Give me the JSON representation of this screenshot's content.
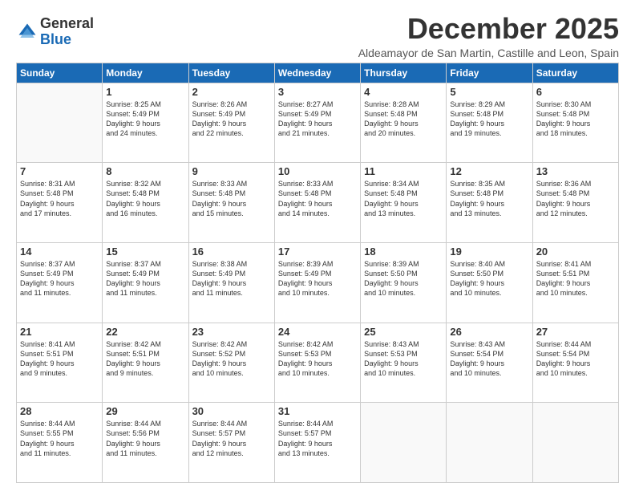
{
  "logo": {
    "general": "General",
    "blue": "Blue"
  },
  "title": "December 2025",
  "subtitle": "Aldeamayor de San Martin, Castille and Leon, Spain",
  "days_of_week": [
    "Sunday",
    "Monday",
    "Tuesday",
    "Wednesday",
    "Thursday",
    "Friday",
    "Saturday"
  ],
  "weeks": [
    [
      {
        "day": "",
        "info": ""
      },
      {
        "day": "1",
        "info": "Sunrise: 8:25 AM\nSunset: 5:49 PM\nDaylight: 9 hours\nand 24 minutes."
      },
      {
        "day": "2",
        "info": "Sunrise: 8:26 AM\nSunset: 5:49 PM\nDaylight: 9 hours\nand 22 minutes."
      },
      {
        "day": "3",
        "info": "Sunrise: 8:27 AM\nSunset: 5:49 PM\nDaylight: 9 hours\nand 21 minutes."
      },
      {
        "day": "4",
        "info": "Sunrise: 8:28 AM\nSunset: 5:48 PM\nDaylight: 9 hours\nand 20 minutes."
      },
      {
        "day": "5",
        "info": "Sunrise: 8:29 AM\nSunset: 5:48 PM\nDaylight: 9 hours\nand 19 minutes."
      },
      {
        "day": "6",
        "info": "Sunrise: 8:30 AM\nSunset: 5:48 PM\nDaylight: 9 hours\nand 18 minutes."
      }
    ],
    [
      {
        "day": "7",
        "info": "Sunrise: 8:31 AM\nSunset: 5:48 PM\nDaylight: 9 hours\nand 17 minutes."
      },
      {
        "day": "8",
        "info": "Sunrise: 8:32 AM\nSunset: 5:48 PM\nDaylight: 9 hours\nand 16 minutes."
      },
      {
        "day": "9",
        "info": "Sunrise: 8:33 AM\nSunset: 5:48 PM\nDaylight: 9 hours\nand 15 minutes."
      },
      {
        "day": "10",
        "info": "Sunrise: 8:33 AM\nSunset: 5:48 PM\nDaylight: 9 hours\nand 14 minutes."
      },
      {
        "day": "11",
        "info": "Sunrise: 8:34 AM\nSunset: 5:48 PM\nDaylight: 9 hours\nand 13 minutes."
      },
      {
        "day": "12",
        "info": "Sunrise: 8:35 AM\nSunset: 5:48 PM\nDaylight: 9 hours\nand 13 minutes."
      },
      {
        "day": "13",
        "info": "Sunrise: 8:36 AM\nSunset: 5:48 PM\nDaylight: 9 hours\nand 12 minutes."
      }
    ],
    [
      {
        "day": "14",
        "info": "Sunrise: 8:37 AM\nSunset: 5:49 PM\nDaylight: 9 hours\nand 11 minutes."
      },
      {
        "day": "15",
        "info": "Sunrise: 8:37 AM\nSunset: 5:49 PM\nDaylight: 9 hours\nand 11 minutes."
      },
      {
        "day": "16",
        "info": "Sunrise: 8:38 AM\nSunset: 5:49 PM\nDaylight: 9 hours\nand 11 minutes."
      },
      {
        "day": "17",
        "info": "Sunrise: 8:39 AM\nSunset: 5:49 PM\nDaylight: 9 hours\nand 10 minutes."
      },
      {
        "day": "18",
        "info": "Sunrise: 8:39 AM\nSunset: 5:50 PM\nDaylight: 9 hours\nand 10 minutes."
      },
      {
        "day": "19",
        "info": "Sunrise: 8:40 AM\nSunset: 5:50 PM\nDaylight: 9 hours\nand 10 minutes."
      },
      {
        "day": "20",
        "info": "Sunrise: 8:41 AM\nSunset: 5:51 PM\nDaylight: 9 hours\nand 10 minutes."
      }
    ],
    [
      {
        "day": "21",
        "info": "Sunrise: 8:41 AM\nSunset: 5:51 PM\nDaylight: 9 hours\nand 9 minutes."
      },
      {
        "day": "22",
        "info": "Sunrise: 8:42 AM\nSunset: 5:51 PM\nDaylight: 9 hours\nand 9 minutes."
      },
      {
        "day": "23",
        "info": "Sunrise: 8:42 AM\nSunset: 5:52 PM\nDaylight: 9 hours\nand 10 minutes."
      },
      {
        "day": "24",
        "info": "Sunrise: 8:42 AM\nSunset: 5:53 PM\nDaylight: 9 hours\nand 10 minutes."
      },
      {
        "day": "25",
        "info": "Sunrise: 8:43 AM\nSunset: 5:53 PM\nDaylight: 9 hours\nand 10 minutes."
      },
      {
        "day": "26",
        "info": "Sunrise: 8:43 AM\nSunset: 5:54 PM\nDaylight: 9 hours\nand 10 minutes."
      },
      {
        "day": "27",
        "info": "Sunrise: 8:44 AM\nSunset: 5:54 PM\nDaylight: 9 hours\nand 10 minutes."
      }
    ],
    [
      {
        "day": "28",
        "info": "Sunrise: 8:44 AM\nSunset: 5:55 PM\nDaylight: 9 hours\nand 11 minutes."
      },
      {
        "day": "29",
        "info": "Sunrise: 8:44 AM\nSunset: 5:56 PM\nDaylight: 9 hours\nand 11 minutes."
      },
      {
        "day": "30",
        "info": "Sunrise: 8:44 AM\nSunset: 5:57 PM\nDaylight: 9 hours\nand 12 minutes."
      },
      {
        "day": "31",
        "info": "Sunrise: 8:44 AM\nSunset: 5:57 PM\nDaylight: 9 hours\nand 13 minutes."
      },
      {
        "day": "",
        "info": ""
      },
      {
        "day": "",
        "info": ""
      },
      {
        "day": "",
        "info": ""
      }
    ]
  ]
}
